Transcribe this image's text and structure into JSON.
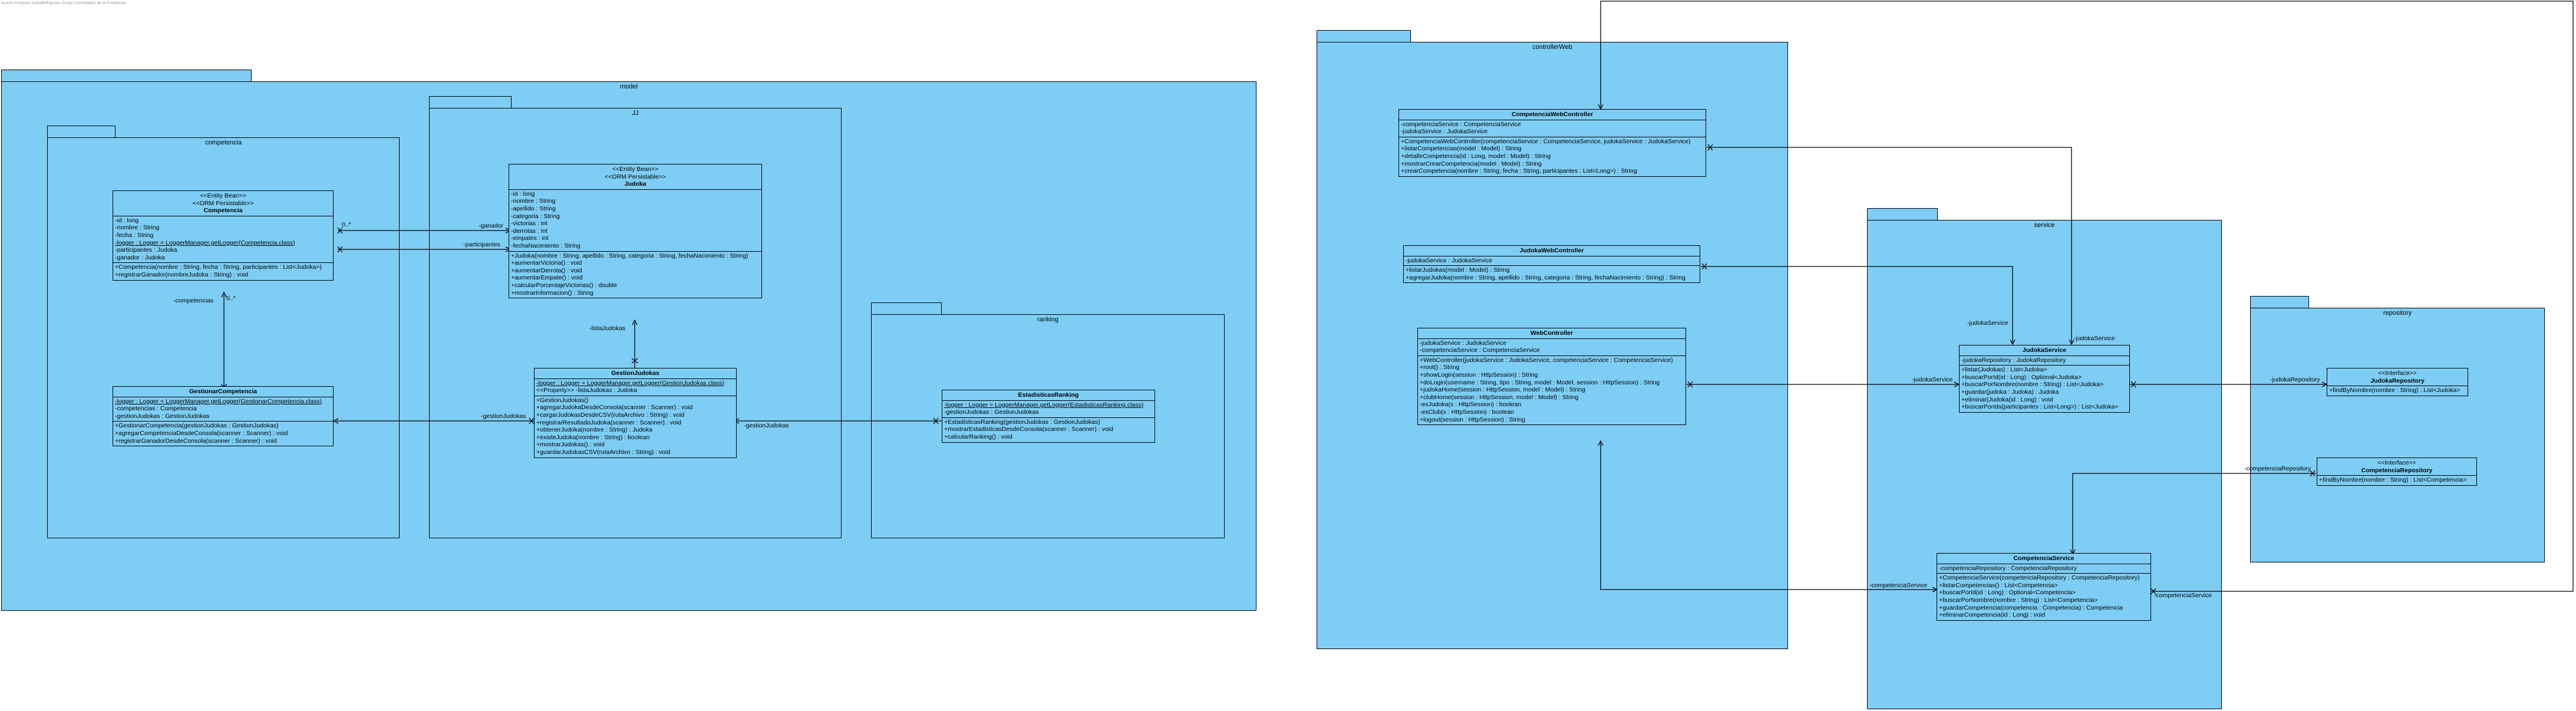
{
  "caption": "Nuevo Proyecto Grande/Figuras Grupo Controlador de la Fundación",
  "packages": {
    "model": "model",
    "competencia": "competencia",
    "jj": "JJ",
    "ranking": "ranking",
    "controllerWeb": "controllerWeb",
    "service": "service",
    "repository": "repository"
  },
  "classes": {
    "competencia": {
      "stereotypes": [
        "<<Entity Bean>>",
        "<<ORM Persistable>>"
      ],
      "name": "Competencia",
      "attributes": [
        "-id : long",
        "-nombre : String",
        "-fecha : String",
        "-logger : Logger = LoggerManager.getLogger(Competencia.class)",
        "-participantes : Judoka",
        "-ganador : Judoka"
      ],
      "underlineIndex": 3,
      "methods": [
        "+Competencia(nombre : String, fecha : String, participantes : List<Judoka>)",
        "+registrarGanador(nombreJudoka : String) : void"
      ]
    },
    "judoka": {
      "stereotypes": [
        "<<Entity Bean>>",
        "<<ORM Persistable>>"
      ],
      "name": "Judoka",
      "attributes": [
        "-id : long",
        "-nombre : String",
        "-apellido : String",
        "-categoria : String",
        "-victorias : int",
        "-derrotas : int",
        "-empates : int",
        "-fechaNacimiento : String"
      ],
      "methods": [
        "+Judoka(nombre : String, apellido : String, categoria : String, fechaNacimiento : String)",
        "+aumentarVictoria() : void",
        "+aumentarDerrota() : void",
        "+aumentarEmpate() : void",
        "+calcularPorcentajeVictorias() : double",
        "+mostrarInformacion() : String"
      ]
    },
    "gestionarCompetencia": {
      "name": "GestionarCompetencia",
      "attributes": [
        "-logger : Logger = LoggerManager.getLogger(GestionarCompetencia.class)",
        "-competencias : Competencia",
        "-gestionJudokas : GestionJudokas"
      ],
      "underlineIndex": 0,
      "methods": [
        "+GestionarCompetencia(gestionJudokas : GestionJudokas)",
        "+agregarCompetenciaDesdeConsola(scanner : Scanner) : void",
        "+registrarGanadorDesdeConsola(scanner : Scanner) : void"
      ]
    },
    "gestionJudokas": {
      "name": "GestionJudokas",
      "attributes": [
        "-logger : Logger = LoggerManager.getLogger(GestionJudokas.class)",
        "<<Property>> -listaJudokas : Judoka"
      ],
      "underlineIndex": 0,
      "methods": [
        "+GestionJudokas()",
        "+agregarJudokaDesdeConsola(scanner : Scanner) : void",
        "+cargarJudokasDesdeCSV(rutaArchivo : String) : void",
        "+registrarResultadoJudoka(scanner : Scanner) : void",
        "+obtenerJudoka(nombre : String) : Judoka",
        "+existeJudoka(nombre : String) : boolean",
        "+mostrarJudokas() : void",
        "+guardarJudokasCSV(rutaArchivo : String) : void"
      ]
    },
    "estadisticasRanking": {
      "name": "EstadisticasRanking",
      "attributes": [
        "-logger : Logger = LoggerManager.getLogger(EstadisticasRanking.class)",
        "-gestionJudokas : GestionJudokas"
      ],
      "underlineIndex": 0,
      "methods": [
        "+EstadisticasRanking(gestionJudokas : GestionJudokas)",
        "+mostrarEstadisticasDesdeConsola(scanner : Scanner) : void",
        "+calcularRanking() : void"
      ]
    },
    "competenciaWebController": {
      "name": "CompetenciaWebController",
      "attributes": [
        "-competenciaService : CompetenciaService",
        "-judokaService : JudokaService"
      ],
      "methods": [
        "+CompetenciaWebController(competenciaService : CompetenciaService, judokaService : JudokaService)",
        "+listarCompetencias(model : Model) : String",
        "+detalleCompetencia(id : Long, model : Model) : String",
        "+mostrarCrearCompetencia(model : Model) : String",
        "+crearCompetencia(nombre : String, fecha : String, participantes : List<Long>) : String"
      ]
    },
    "judokaWebController": {
      "name": "JudokaWebController",
      "attributes": [
        "-judokaService : JudokaService"
      ],
      "methods": [
        "+listarJudokas(model : Model) : String",
        "+agregarJudoka(nombre : String, apellido : String, categoria : String, fechaNacimiento : String) : String"
      ]
    },
    "webController": {
      "name": "WebController",
      "attributes": [
        "-judokaService : JudokaService",
        "-competenciaService : CompetenciaService"
      ],
      "methods": [
        "+WebController(judokaService : JudokaService, competenciaService : CompetenciaService)",
        "+root() : String",
        "+showLogin(session : HttpSession) : String",
        "+doLogin(username : String, tipo : String, model : Model, session : HttpSession) : String",
        "+judokaHome(session : HttpSession, model : Model) : String",
        "+clubHome(session : HttpSession, model : Model) : String",
        "-esJudoka(s : HttpSession) : boolean",
        "-esClub(s : HttpSession) : boolean",
        "+logout(session : HttpSession) : String"
      ]
    },
    "judokaService": {
      "name": "JudokaService",
      "attributes": [
        "-judokaRepository : JudokaRepository"
      ],
      "methods": [
        "+listar(Judokas) : List<Judoka>",
        "+buscarPorId(id : Long) : Optional<Judoka>",
        "+buscarPorNombre(nombre : String) : List<Judoka>",
        "+guardar(judoka : Judoka) : Judoka",
        "+eliminar(Judoka(id : Long) : void",
        "+buscarPorIds(participantes : List<Long>) : List<Judoka>"
      ]
    },
    "competenciaService": {
      "name": "CompetenciaService",
      "attributes": [
        "-competenciaRepository : CompetenciaRepository"
      ],
      "methods": [
        "+CompetenciaService(competenciaRepository : CompetenciaRepository)",
        "+listarCompetencias() : List<Competencia>",
        "+buscarPorId(id : Long) : Optional<Competencia>",
        "+buscarPorNombre(nombre : String) : List<Competencia>",
        "+guardarCompetencia(competencia : Competencia) : Competencia",
        "+eliminarCompetencia(id : Long) : void"
      ]
    },
    "judokaRepository": {
      "stereotypes": [
        "<<Interface>>"
      ],
      "name": "JudokaRepository",
      "methods": [
        "+findByNombre(nombre : String) : List<Judoka>"
      ]
    },
    "competenciaRepository": {
      "stereotypes": [
        "<<Interface>>"
      ],
      "name": "CompetenciaRepository",
      "methods": [
        "+findByNombre(nombre : String) : List<Competencia>"
      ]
    }
  },
  "edgeLabels": {
    "ganador": "-ganador",
    "participantes": "-participantes",
    "mult1": "0..*",
    "mult2": "0..*",
    "competencias": "-competencias",
    "listaJudokas": "-listaJudokas",
    "gestionJudokas1": "-gestionJudokas",
    "gestionJudokas2": "-gestionJudokas",
    "judokaService1": "-judokaService",
    "judokaService2": "-judokaService",
    "judokaService3": "-judokaService",
    "judokaRepository": "-judokaRepository",
    "competenciaRepository": "-competenciaRepository",
    "competenciaService1": "-competenciaService",
    "competenciaService2": "-competenciaService"
  }
}
